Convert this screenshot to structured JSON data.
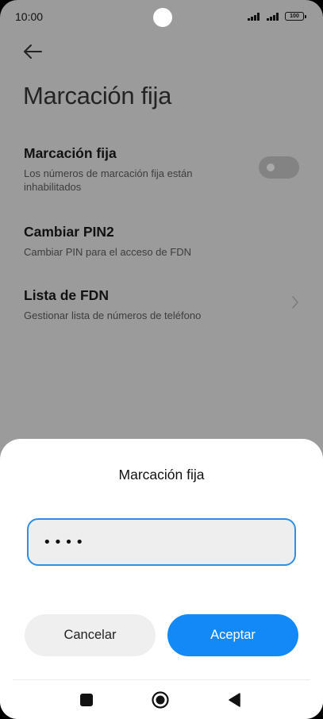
{
  "status_bar": {
    "time": "10:00",
    "battery": "100"
  },
  "page": {
    "title": "Marcación fija"
  },
  "settings": [
    {
      "title": "Marcación fija",
      "subtitle": "Los números de marcación fija están inhabilitados"
    },
    {
      "title": "Cambiar PIN2",
      "subtitle": "Cambiar PIN para el acceso de FDN"
    },
    {
      "title": "Lista de FDN",
      "subtitle": "Gestionar lista de números de teléfono"
    }
  ],
  "fdn_toggle": {
    "enabled": false
  },
  "dialog": {
    "title": "Marcación fija",
    "pin_value": "1234",
    "cancel_label": "Cancelar",
    "accept_label": "Aceptar"
  },
  "colors": {
    "accent": "#1289f6",
    "input_border": "#2f8fe4",
    "dim_background": "#9b9b9b"
  },
  "icons": {
    "back": "arrow-left-icon",
    "chevron": "chevron-right-icon",
    "nav": [
      "square-icon",
      "circle-icon",
      "triangle-icon"
    ]
  }
}
